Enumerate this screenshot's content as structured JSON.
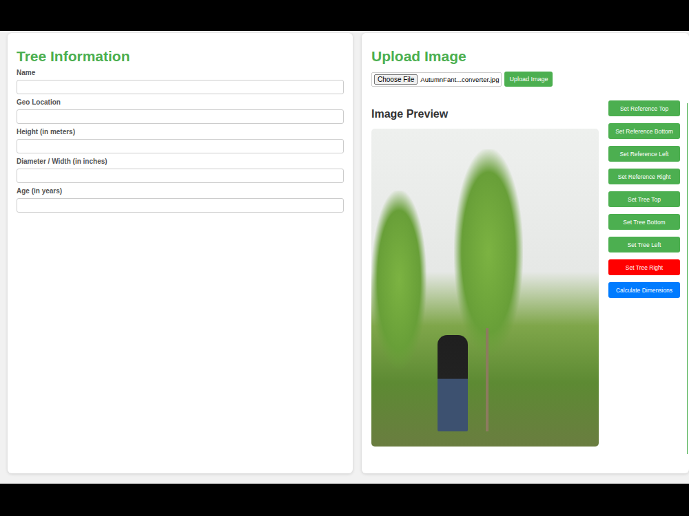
{
  "tree_info": {
    "title": "Tree Information",
    "fields": [
      {
        "label": "Name"
      },
      {
        "label": "Geo Location"
      },
      {
        "label": "Height (in meters)"
      },
      {
        "label": "Diameter / Width (in inches)"
      },
      {
        "label": "Age (in years)"
      }
    ]
  },
  "upload": {
    "title": "Upload Image",
    "choose_label": "Choose File",
    "file_name": "AutumnFant...converter.jpg",
    "upload_button": "Upload Image"
  },
  "preview": {
    "title": "Image Preview"
  },
  "buttons": [
    {
      "label": "Set Reference Top",
      "kind": "set",
      "selected": false
    },
    {
      "label": "Set Reference Bottom",
      "kind": "set",
      "selected": false
    },
    {
      "label": "Set Reference Left",
      "kind": "set",
      "selected": false
    },
    {
      "label": "Set Reference Right",
      "kind": "set",
      "selected": false
    },
    {
      "label": "Set Tree Top",
      "kind": "set",
      "selected": false
    },
    {
      "label": "Set Tree Bottom",
      "kind": "set",
      "selected": false
    },
    {
      "label": "Set Tree Left",
      "kind": "set",
      "selected": false
    },
    {
      "label": "Set Tree Right",
      "kind": "set",
      "selected": true
    },
    {
      "label": "Calculate Dimensions",
      "kind": "calculate",
      "selected": false
    }
  ]
}
